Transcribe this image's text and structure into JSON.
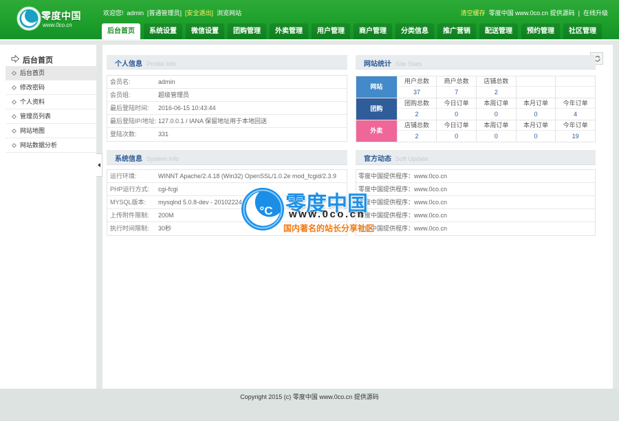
{
  "header": {
    "logo": {
      "name": "零度中国",
      "url": "www.0co.cn"
    },
    "welcome": "欢迎您!",
    "username": "admin",
    "role": "[普通管理员]",
    "logout": "[安全退出]",
    "browse_site": "浏览网站",
    "clear_cache": "清空缓存",
    "credit": "零度中国 www.0co.cn 提供源码",
    "separator": "|",
    "upgrade": "在线升级"
  },
  "nav": {
    "tabs": [
      {
        "label": "后台首页",
        "active": true
      },
      {
        "label": "系统设置"
      },
      {
        "label": "微信设置"
      },
      {
        "label": "团购管理"
      },
      {
        "label": "外卖管理"
      },
      {
        "label": "用户管理"
      },
      {
        "label": "商户管理"
      },
      {
        "label": "分类信息"
      },
      {
        "label": "推广营销"
      },
      {
        "label": "配送管理"
      },
      {
        "label": "预约管理"
      },
      {
        "label": "社区管理"
      }
    ]
  },
  "sidebar": {
    "title": "后台首页",
    "items": [
      {
        "label": "后台首页",
        "active": true
      },
      {
        "label": "修改密码"
      },
      {
        "label": "个人资料"
      },
      {
        "label": "管理员列表"
      },
      {
        "label": "网站地图"
      },
      {
        "label": "网站数据分析"
      }
    ]
  },
  "profile": {
    "title": "个人信息",
    "subtitle": "Profile Info",
    "rows": [
      {
        "label": "会员名:",
        "value": "admin"
      },
      {
        "label": "会员组:",
        "value": "超级管理员"
      },
      {
        "label": "最后登陆时间:",
        "value": "2016-06-15 10:43:44"
      },
      {
        "label": "最后登陆IP/地址:",
        "value": "127.0.0.1 / IANA 保留地址用于本地回送"
      },
      {
        "label": "登陆次数:",
        "value": "331"
      }
    ]
  },
  "stats": {
    "title": "网站统计",
    "subtitle": "Site Stats",
    "groups": [
      {
        "name": "网站",
        "color": "#428ac9",
        "cells": [
          {
            "label": "用户总数",
            "value": "37"
          },
          {
            "label": "商户总数",
            "value": "7"
          },
          {
            "label": "店铺总数",
            "value": "2"
          }
        ]
      },
      {
        "name": "团购",
        "color": "#2f5d9a",
        "cells": [
          {
            "label": "团购总数",
            "value": "2"
          },
          {
            "label": "今日订单",
            "value": "0"
          },
          {
            "label": "本周订单",
            "value": "0"
          },
          {
            "label": "本月订单",
            "value": "0"
          },
          {
            "label": "今年订单",
            "value": "4"
          }
        ]
      },
      {
        "name": "外卖",
        "color": "#ef6699",
        "cells": [
          {
            "label": "店铺总数",
            "value": "2"
          },
          {
            "label": "今日订单",
            "value": "0"
          },
          {
            "label": "本周订单",
            "value": "0"
          },
          {
            "label": "本月订单",
            "value": "0"
          },
          {
            "label": "今年订单",
            "value": "19"
          }
        ]
      }
    ]
  },
  "system": {
    "title": "系统信息",
    "subtitle": "System Info",
    "rows": [
      {
        "label": "运行环境:",
        "value": "WINNT Apache/2.4.18 (Win32) OpenSSL/1.0.2e mod_fcgid/2.3.9"
      },
      {
        "label": "PHP运行方式:",
        "value": "cgi-fcgi"
      },
      {
        "label": "MYSQL版本:",
        "value": "mysqlnd 5.0.8-dev - 20102224"
      },
      {
        "label": "上传附件限制:",
        "value": "200M"
      },
      {
        "label": "执行时间限制:",
        "value": "30秒"
      }
    ]
  },
  "updates": {
    "title": "官方动态",
    "subtitle": "Soft Update",
    "items": [
      {
        "text": "零度中国提供程序：www.0co.cn"
      },
      {
        "text": "零度中国提供程序：www.0co.cn"
      },
      {
        "text": "零度中国提供程序：www.0co.cn"
      },
      {
        "text": "零度中国提供程序：www.0co.cn"
      },
      {
        "text": "零度中国提供程序：www.0co.cn"
      }
    ]
  },
  "watermark": {
    "symbol": "°C",
    "name": "零度中国",
    "url": "www.0co.cn",
    "slogan": "国内著名的站长分享社区"
  },
  "footer": {
    "copyright": "Copyright 2015 (c) 零度中国 www.0co.cn 提供源码"
  },
  "icons": {
    "logo": "logo-icon",
    "sidebar_title": "home-arrow-icon",
    "sidebar_item": "bullet-icon",
    "collapse": "collapse-arrow-icon",
    "refresh": "refresh-icon",
    "watermark": "watermark-logo-icon"
  },
  "colors": {
    "header_green": "#1ea02b",
    "tab_green": "#0e7f1e",
    "accent_yellow": "#fff36b",
    "title_blue": "#2b5a96",
    "watermark_blue": "#1e90e6",
    "watermark_orange": "#f27a12"
  }
}
